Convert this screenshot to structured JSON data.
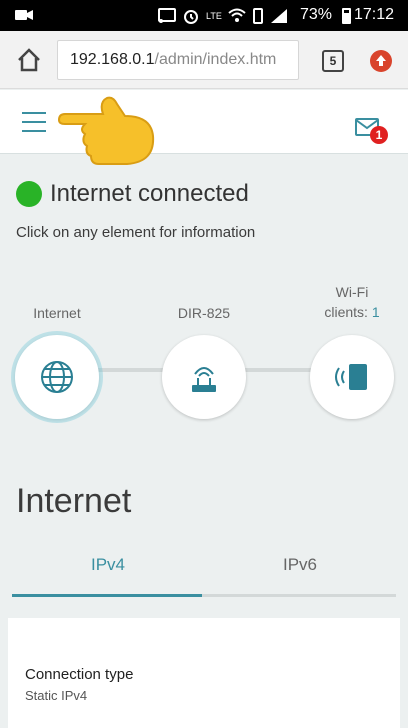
{
  "status_bar": {
    "battery": "73%",
    "time": "17:12",
    "network": "LTE"
  },
  "browser": {
    "url_host": "192.168.0.1",
    "url_path": "/admin/index.htm",
    "tab_count": "5"
  },
  "header": {
    "unread_count": "1"
  },
  "status": {
    "text": "Internet connected",
    "color": "#29b327",
    "hint": "Click on any element for information"
  },
  "nodes": {
    "internet_label": "Internet",
    "router_label": "DIR-825",
    "wifi_label_line1": "Wi-Fi",
    "wifi_label_line2": "clients:",
    "wifi_count": "1"
  },
  "section": {
    "title": "Internet"
  },
  "tabs": [
    {
      "label": "IPv4",
      "active": true
    },
    {
      "label": "IPv6",
      "active": false
    }
  ],
  "connection": {
    "label": "Connection type",
    "value": "Static IPv4"
  },
  "colors": {
    "accent": "#3a8fa0",
    "badge": "#e02020"
  }
}
